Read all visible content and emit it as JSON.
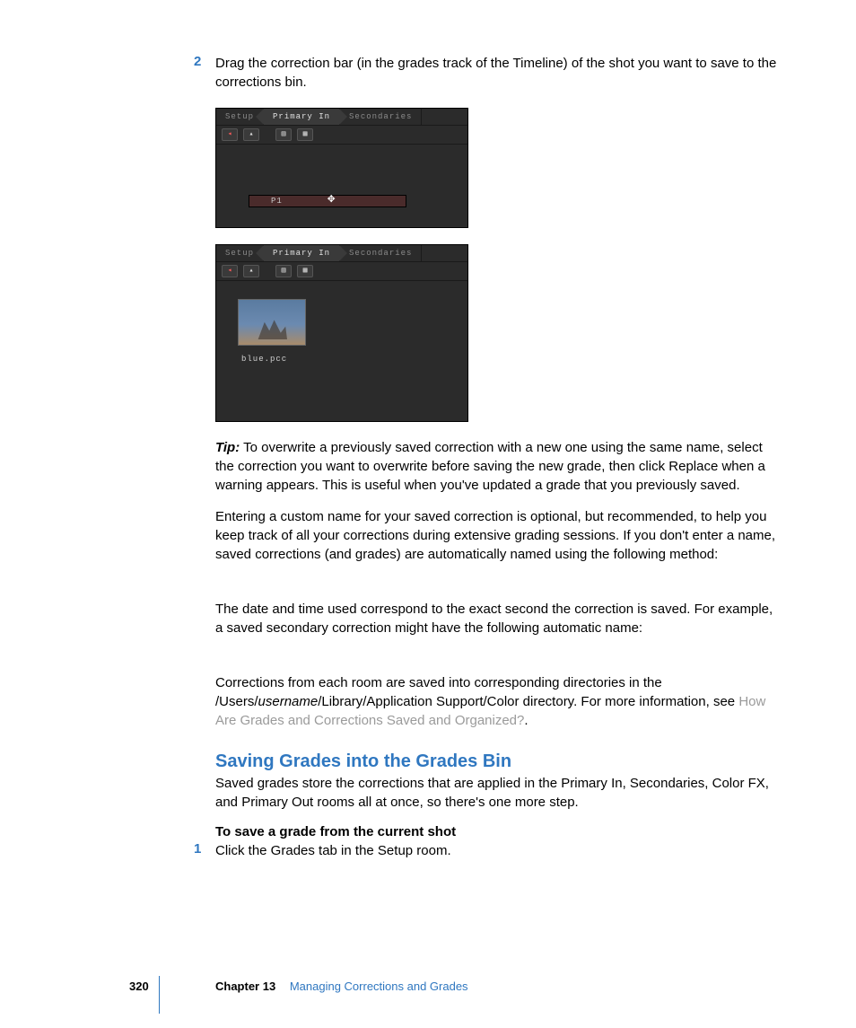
{
  "step2": {
    "num": "2",
    "text": "Drag the correction bar (in the grades track of the Timeline) of the shot you want to save to the corrections bin."
  },
  "shot1": {
    "tabs": {
      "setup": "Setup",
      "primary": "Primary In",
      "secondaries": "Secondaries"
    },
    "bar_label": "P1"
  },
  "shot2": {
    "tabs": {
      "setup": "Setup",
      "primary": "Primary In",
      "secondaries": "Secondaries"
    },
    "thumb_label": "blue.pcc"
  },
  "tip": {
    "label": "Tip:",
    "text": "  To overwrite a previously saved correction with a new one using the same name, select the correction you want to overwrite before saving the new grade, then click Replace when a warning appears. This is useful when you've updated a grade that you previously saved."
  },
  "para_naming": "Entering a custom name for your saved correction is optional, but recommended, to help you keep track of all your corrections during extensive grading sessions. If you don't enter a name, saved corrections (and grades) are automatically named using the following method:",
  "para_datetime": "The date and time used correspond to the exact second the correction is saved. For example, a saved secondary correction might have the following automatic name:",
  "para_path_lead": "Corrections from each room are saved into corresponding directories in the /Users/",
  "para_path_user": "username",
  "para_path_tail": "/Library/Application Support/Color directory. For more information, see ",
  "para_path_link": "How Are Grades and Corrections Saved and Organized?",
  "para_path_period": ".",
  "section_heading": "Saving Grades into the Grades Bin",
  "section_intro": "Saved grades store the corrections that are applied in the Primary In, Secondaries, Color FX, and Primary Out rooms all at once, so there's one more step.",
  "howto_heading": "To save a grade from the current shot",
  "step1": {
    "num": "1",
    "text": "Click the Grades tab in the Setup room."
  },
  "footer": {
    "page": "320",
    "chapter_label": "Chapter 13",
    "chapter_title": "Managing Corrections and Grades"
  }
}
